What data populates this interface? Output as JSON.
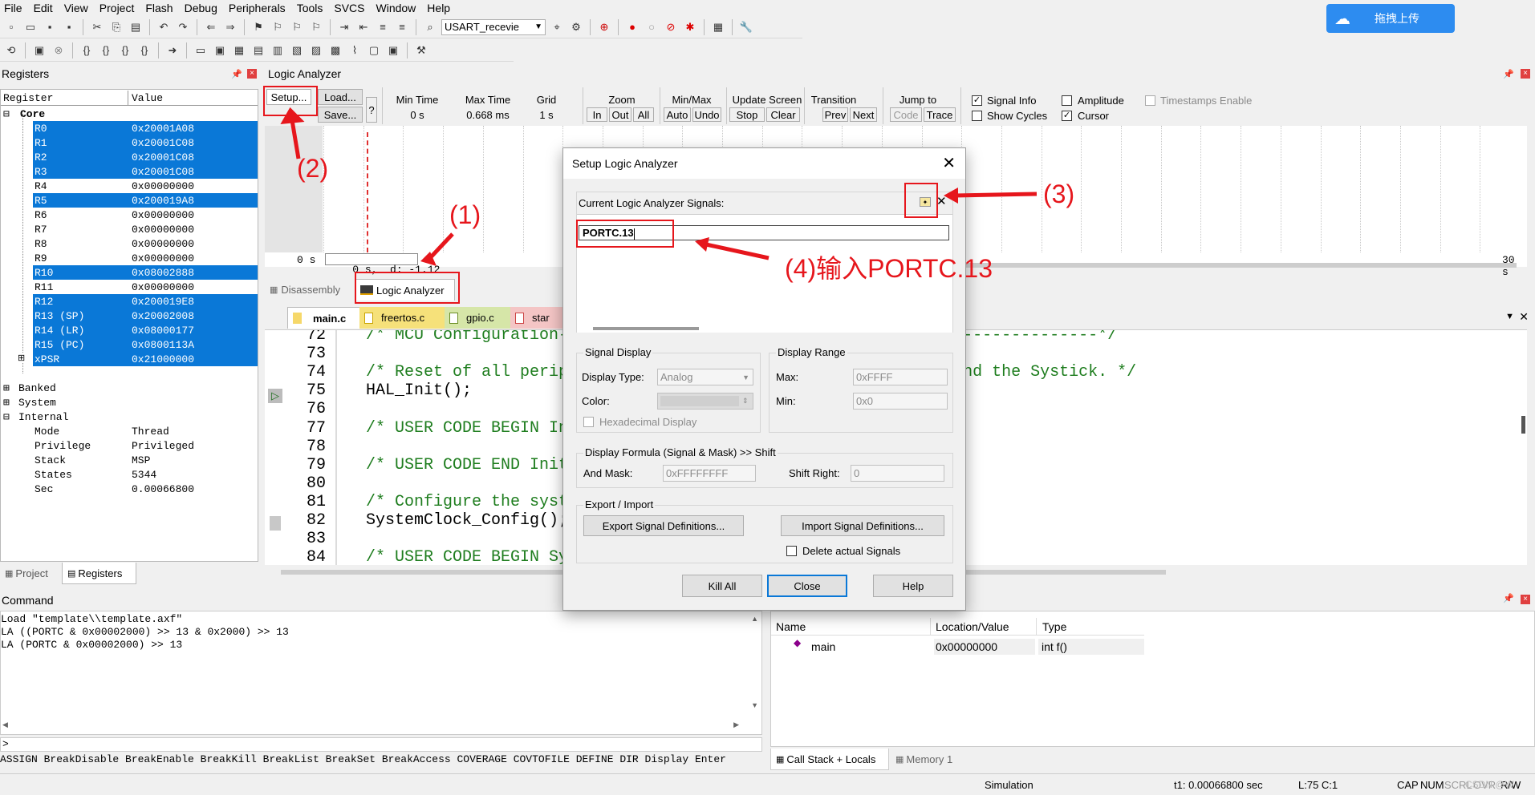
{
  "menu": [
    "File",
    "Edit",
    "View",
    "Project",
    "Flash",
    "Debug",
    "Peripherals",
    "Tools",
    "SVCS",
    "Window",
    "Help"
  ],
  "toolbar": {
    "target": "USART_recevie"
  },
  "upload_button": "拖拽上传",
  "registers_panel": {
    "title": "Registers",
    "col_register": "Register",
    "col_value": "Value",
    "group_core": "Core",
    "rows": [
      {
        "name": "R0",
        "value": "0x20001A08",
        "selected": true
      },
      {
        "name": "R1",
        "value": "0x20001C08",
        "selected": true
      },
      {
        "name": "R2",
        "value": "0x20001C08",
        "selected": true
      },
      {
        "name": "R3",
        "value": "0x20001C08",
        "selected": true
      },
      {
        "name": "R4",
        "value": "0x00000000",
        "selected": false
      },
      {
        "name": "R5",
        "value": "0x200019A8",
        "selected": true
      },
      {
        "name": "R6",
        "value": "0x00000000",
        "selected": false
      },
      {
        "name": "R7",
        "value": "0x00000000",
        "selected": false
      },
      {
        "name": "R8",
        "value": "0x00000000",
        "selected": false
      },
      {
        "name": "R9",
        "value": "0x00000000",
        "selected": false
      },
      {
        "name": "R10",
        "value": "0x08002888",
        "selected": true
      },
      {
        "name": "R11",
        "value": "0x00000000",
        "selected": false
      },
      {
        "name": "R12",
        "value": "0x200019E8",
        "selected": true
      },
      {
        "name": "R13 (SP)",
        "value": "0x20002008",
        "selected": true
      },
      {
        "name": "R14 (LR)",
        "value": "0x08000177",
        "selected": true
      },
      {
        "name": "R15 (PC)",
        "value": "0x0800113A",
        "selected": true
      },
      {
        "name": "xPSR",
        "value": "0x21000000",
        "selected": true
      }
    ],
    "groups": [
      "Banked",
      "System",
      "Internal"
    ],
    "internal": [
      {
        "name": "Mode",
        "value": "Thread"
      },
      {
        "name": "Privilege",
        "value": "Privileged"
      },
      {
        "name": "Stack",
        "value": "MSP"
      },
      {
        "name": "States",
        "value": "5344"
      },
      {
        "name": "Sec",
        "value": "0.00066800"
      }
    ],
    "tabs": [
      "Project",
      "Registers"
    ]
  },
  "logic_analyzer": {
    "title": "Logic Analyzer",
    "setup": "Setup...",
    "load": "Load...",
    "save": "Save...",
    "help": "?",
    "min_time_label": "Min Time",
    "min_time": "0 s",
    "max_time_label": "Max Time",
    "max_time": "0.668 ms",
    "grid_label": "Grid",
    "grid": "1 s",
    "zoom_label": "Zoom",
    "zoom_in": "In",
    "zoom_out": "Out",
    "zoom_all": "All",
    "minmax_label": "Min/Max",
    "auto": "Auto",
    "undo": "Undo",
    "update_label": "Update Screen",
    "stop": "Stop",
    "clear": "Clear",
    "transition_label": "Transition",
    "prev": "Prev",
    "next": "Next",
    "jump_label": "Jump to",
    "code": "Code",
    "trace": "Trace",
    "signal_info": "Signal Info",
    "show_cycles": "Show Cycles",
    "amplitude": "Amplitude",
    "cursor": "Cursor",
    "timestamps": "Timestamps Enable",
    "time_start": "0 s",
    "cursor_readout": "0 s,  d: -1.12",
    "time_end": "30 s"
  },
  "view_tabs": {
    "disassembly": "Disassembly",
    "logic": "Logic Analyzer"
  },
  "file_tabs": [
    "main.c",
    "freertos.c",
    "gpio.c",
    "star"
  ],
  "code": [
    {
      "n": "72",
      "text": "/* MCU Configuration--------------------------------------------------------*/",
      "color": "#1e7d1e"
    },
    {
      "n": "73",
      "text": "",
      "color": "#000"
    },
    {
      "n": "74",
      "text": "/* Reset of all peripherals, Initializes the Flash interface and the Systick. */",
      "color": "#1e7d1e"
    },
    {
      "n": "75",
      "text": "HAL_Init();",
      "color": "#000"
    },
    {
      "n": "76",
      "text": "",
      "color": "#000"
    },
    {
      "n": "77",
      "text": "/* USER CODE BEGIN Init */",
      "color": "#1e7d1e"
    },
    {
      "n": "78",
      "text": "",
      "color": "#000"
    },
    {
      "n": "79",
      "text": "/* USER CODE END Init */",
      "color": "#1e7d1e"
    },
    {
      "n": "80",
      "text": "",
      "color": "#000"
    },
    {
      "n": "81",
      "text": "/* Configure the system clock */",
      "color": "#1e7d1e"
    },
    {
      "n": "82",
      "text": "SystemClock_Config();",
      "color": "#000"
    },
    {
      "n": "83",
      "text": "",
      "color": "#000"
    },
    {
      "n": "84",
      "text": "/* USER CODE BEGIN SysInit */",
      "color": "#1e7d1e"
    }
  ],
  "dialog": {
    "title": "Setup Logic Analyzer",
    "signals_label": "Current Logic Analyzer Signals:",
    "signal_entry": "PORTC.13",
    "signal_display": "Signal Display",
    "display_type_label": "Display Type:",
    "display_type": "Analog",
    "color_label": "Color:",
    "hex_display": "Hexadecimal Display",
    "display_range": "Display Range",
    "max_label": "Max:",
    "max": "0xFFFF",
    "min_label": "Min:",
    "min": "0x0",
    "formula": "Display Formula (Signal & Mask) >> Shift",
    "and_mask_label": "And Mask:",
    "and_mask": "0xFFFFFFFF",
    "shift_right_label": "Shift Right:",
    "shift_right": "0",
    "export_import": "Export / Import",
    "export_btn": "Export Signal Definitions...",
    "import_btn": "Import Signal Definitions...",
    "delete_actual": "Delete actual Signals",
    "kill_all": "Kill All",
    "close": "Close",
    "help": "Help"
  },
  "annotations": {
    "a1": "(1)",
    "a2": "(2)",
    "a3": "(3)",
    "a4": "(4)输入PORTC.13"
  },
  "command": {
    "title": "Command",
    "lines": [
      "Load \"template\\\\template.axf\"",
      "LA ((PORTC & 0x00002000) >> 13 & 0x2000) >> 13",
      "LA (PORTC & 0x00002000) >> 13"
    ],
    "prompt": ">",
    "hint": "ASSIGN BreakDisable BreakEnable BreakKill BreakList BreakSet BreakAccess COVERAGE COVTOFILE DEFINE DIR Display Enter"
  },
  "callstack": {
    "col_name": "Name",
    "col_location": "Location/Value",
    "col_type": "Type",
    "row_name": "main",
    "row_location": "0x00000000",
    "row_type": "int f()",
    "tabs": [
      "Call Stack + Locals",
      "Memory 1"
    ]
  },
  "status": {
    "mode": "Simulation",
    "t1": "t1: 0.00066800 sec",
    "pos": "L:75 C:1",
    "caps": "CAP",
    "num": "NUM",
    "scrl": "SCRL",
    "ovr": "OVR",
    "rw": "R/W",
    "watermark": "CSDN @W"
  },
  "colors": {
    "selection": "#0a78d7",
    "annotation": "#e6161c",
    "comment": "#1e7d1e"
  }
}
